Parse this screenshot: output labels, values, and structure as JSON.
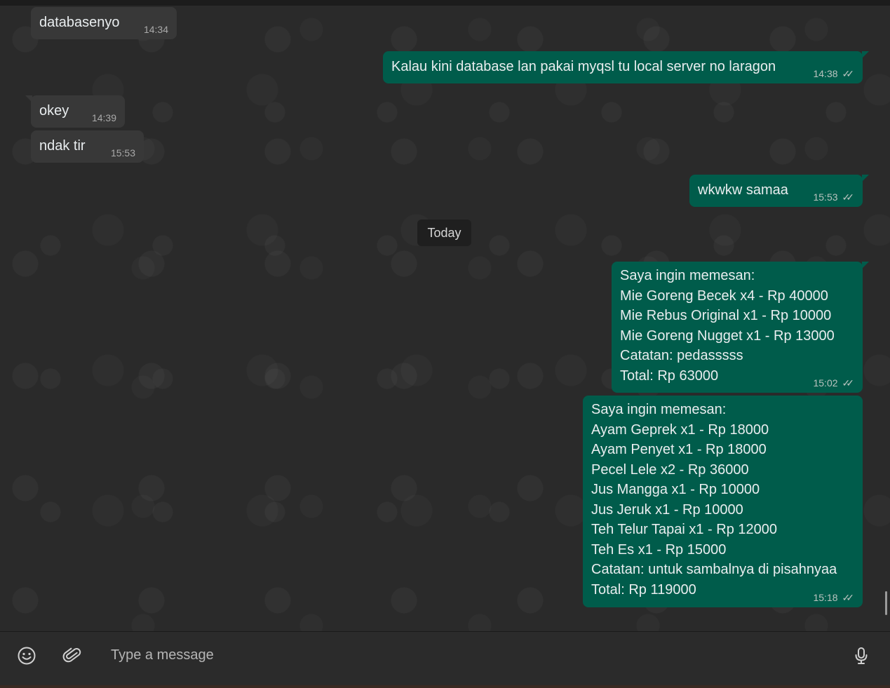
{
  "chat": {
    "messages": [
      {
        "dir": "in",
        "text": "databasenyo",
        "time": "14:34"
      },
      {
        "dir": "out",
        "text": "Kalau kini database lan pakai myqsl tu local server no laragon",
        "time": "14:38"
      },
      {
        "dir": "in",
        "text": "okey",
        "time": "14:39"
      },
      {
        "dir": "in",
        "text": "ndak tir",
        "time": "15:53"
      },
      {
        "dir": "out",
        "text": "wkwkw samaa",
        "time": "15:53"
      },
      {
        "dir": "out",
        "text": "Saya ingin memesan:\nMie Goreng Becek x4 - Rp 40000\nMie Rebus Original x1 - Rp 10000\nMie Goreng Nugget x1 - Rp 13000\nCatatan: pedasssss\nTotal: Rp 63000",
        "time": "15:02"
      },
      {
        "dir": "out",
        "text": "Saya ingin memesan:\nAyam Geprek x1 - Rp 18000\nAyam Penyet x1 - Rp 18000\nPecel Lele x2 - Rp 36000\nJus Mangga x1 - Rp 10000\nJus Jeruk x1 - Rp 10000\nTeh Telur Tapai x1 - Rp 12000\nTeh Es x1 - Rp 15000\nCatatan: untuk sambalnya di pisahnyaa\nTotal: Rp 119000",
        "time": "15:18"
      }
    ],
    "day_separator": "Today"
  },
  "composer": {
    "placeholder": "Type a message",
    "icons": [
      "emoji-icon",
      "attach-icon",
      "mic-icon"
    ]
  },
  "colors": {
    "incoming_bubble": "#383838",
    "outgoing_bubble": "#005c4b",
    "background": "#2a2a2a"
  }
}
